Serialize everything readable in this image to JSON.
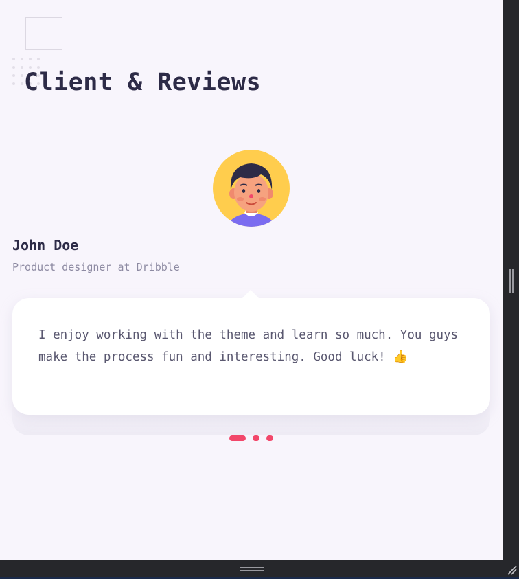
{
  "header": {
    "menu_icon": "hamburger-menu-icon",
    "title": "Client & Reviews"
  },
  "review": {
    "avatar_icon": "avatar-illustration",
    "name": "John Doe",
    "role": "Product designer at Dribble",
    "quote": "I enjoy working with the theme and learn so much. You guys make the process fun and interesting. Good luck! 👍"
  },
  "pager": {
    "count": 3,
    "active_index": 0
  },
  "colors": {
    "page_bg": "#f8f5fc",
    "title": "#2d2b47",
    "accent": "#f2476a",
    "avatar_bg": "#ffcd4d",
    "muted_text": "#8d8aa2"
  }
}
